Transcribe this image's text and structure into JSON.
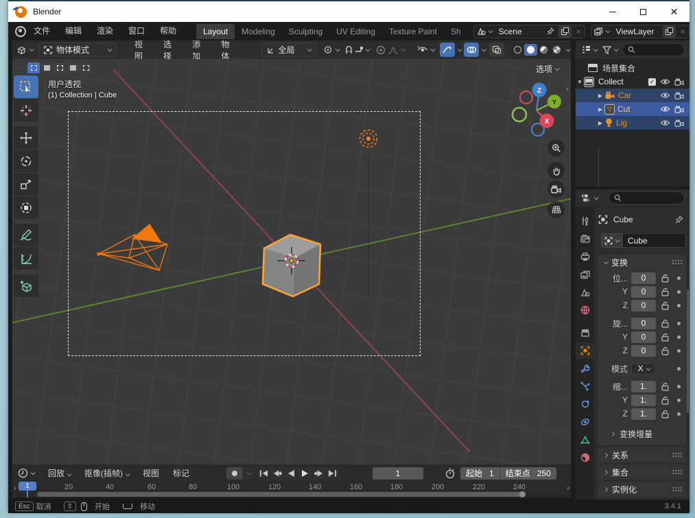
{
  "colors": {
    "accent_blue": "#4772b3",
    "selection_orange": "#ffa133",
    "object_orange": "#e8902a",
    "axis_x_red": "#a04a52",
    "axis_y_green": "#6a9b2f",
    "gizmo_x": "#e0455a",
    "gizmo_y": "#7fae2b",
    "gizmo_z": "#3d7fd0"
  },
  "window": {
    "title": "Blender"
  },
  "topbar": {
    "menus": [
      "文件",
      "编辑",
      "渲染",
      "窗口",
      "帮助"
    ],
    "workspaces": [
      "Layout",
      "Modeling",
      "Sculpting",
      "UV Editing",
      "Texture Paint",
      "Sh"
    ],
    "scene_value": "Scene",
    "viewlayer_value": "ViewLayer"
  },
  "tool_header": {
    "mode": "物体模式",
    "menus": [
      "视图",
      "选择",
      "添加",
      "物体"
    ],
    "orientation": "全局"
  },
  "viewport": {
    "options_label": "选项",
    "view_label": "用户透视",
    "context_label": "(1) Collection | Cube",
    "axis_z": "Z",
    "axis_y": "Y",
    "axis_x": "X"
  },
  "outliner": {
    "root_label": "场景集合",
    "collection_label": "Collect",
    "items": [
      {
        "label": "Car",
        "type": "camera"
      },
      {
        "label": "Cut",
        "type": "mesh"
      },
      {
        "label": "Lig",
        "type": "light"
      }
    ]
  },
  "properties": {
    "breadcrumb": "Cube",
    "object_name": "Cube",
    "transform": {
      "label": "变换",
      "rows": [
        {
          "label": "位...",
          "value": "0"
        },
        {
          "label": "Y",
          "value": "0"
        },
        {
          "label": "Z",
          "value": "0"
        },
        {
          "label": "旋...",
          "value": "0"
        },
        {
          "label": "Y",
          "value": "0"
        },
        {
          "label": "Z",
          "value": "0"
        },
        {
          "label": "模式",
          "value": "X"
        },
        {
          "label": "缩...",
          "value": "1."
        },
        {
          "label": "Y",
          "value": "1."
        },
        {
          "label": "Z",
          "value": "1."
        }
      ],
      "delta_label": "变换增量"
    },
    "collapsed_panels": [
      "关系",
      "集合",
      "实例化"
    ]
  },
  "timeline": {
    "menus": [
      "回放",
      "抠像(插帧)",
      "视图",
      "标记"
    ],
    "current_frame": "1",
    "start_label": "起始",
    "start_value": "1",
    "end_label": "结束点",
    "end_value": "250",
    "playhead_label": "1",
    "ticks": [
      "20",
      "40",
      "60",
      "80",
      "100",
      "120",
      "140",
      "160",
      "180",
      "200",
      "220",
      "240"
    ]
  },
  "statusbar": {
    "cancel_key": "Esc",
    "cancel_label": "取消",
    "start_label": "开始",
    "move_label": "移动",
    "version": "3.4.1"
  }
}
